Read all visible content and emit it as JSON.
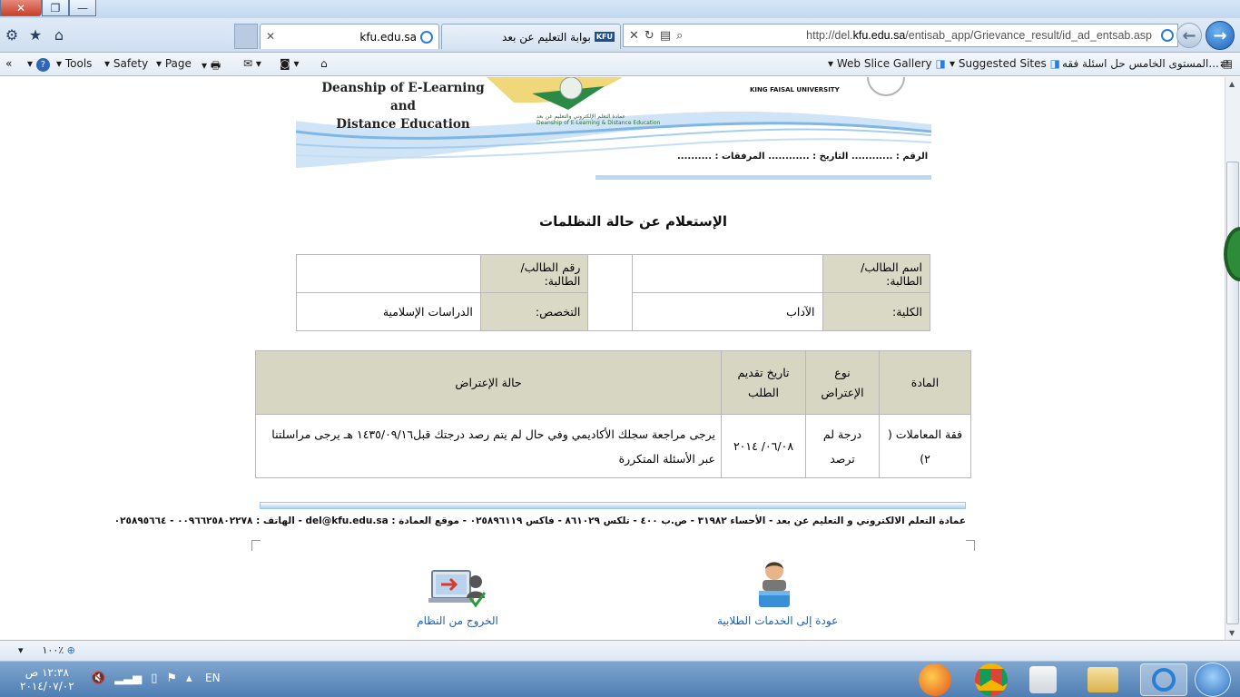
{
  "window": {
    "close_glyph": "✕",
    "restore_glyph": "❐",
    "minimize_glyph": "—"
  },
  "tabs": [
    {
      "label": "kfu.edu.sa",
      "active": true
    },
    {
      "label": "بوابة التعليم عن بعد",
      "active": false
    }
  ],
  "address": {
    "url_prefix": "http://del.",
    "url_domain": "kfu.edu.sa",
    "url_suffix": "/entisab_app/Grievance_result/id_ad_entsab.asp"
  },
  "command_bar": {
    "tools": "Tools",
    "safety": "Safety",
    "page": "Page",
    "web_slice": "Web Slice Gallery",
    "suggested": "Suggested Sites",
    "favorite": "المستوى الخامس حل اسئلة فقه..."
  },
  "letterhead": {
    "dean_line1": "Deanship of E-Learning and",
    "dean_line2": "Distance Education",
    "kfu_en": "KING FAISAL UNIVERSITY",
    "logo_caption_ar": "عمادة التعلم الإلكتروني والتعليم عن بعد",
    "logo_caption_en": "Deanship of E-Learning & Distance Education",
    "meta": "الرقم : ............ التاريخ : ............ المرفقات : .........."
  },
  "page_title": "الإستعلام عن حالة التظلمات",
  "student_info": {
    "name_label": "اسم الطالب/الطالبة:",
    "name_value": "",
    "id_label": "رقم الطالب/الطالبة:",
    "id_value": "",
    "college_label": "الكلية:",
    "college_value": "الآداب",
    "major_label": "التخصص:",
    "major_value": "الدراسات الإسلامية"
  },
  "grievance_table": {
    "headers": {
      "subject": "المادة",
      "type": "نوع الإعتراض",
      "date": "تاريخ تقديم الطلب",
      "status": "حالة الإعتراض"
    },
    "rows": [
      {
        "subject": "فقة المعاملات ( ٢)",
        "type": "درجة لم ترصد",
        "date": "٠٦/٠٨/ ٢٠١٤",
        "status": "يرجى مراجعة سجلك الأكاديمي وفي حال لم يتم رصد درجتك قبل١٤٣٥/٠٩/١٦ هـ يرجى مراسلتنا عبر الأسئلة المتكررة"
      }
    ]
  },
  "footer": {
    "contact": "عمادة التعلم الالكتروني و التعليم عن بعد - الأحساء ٣١٩٨٢ - ص.ب ٤٠٠ - تلكس ٨٦١٠٢٩ - فاكس ٠٢٥٨٩٦١١٩ - موقع العمادة : del@kfu.edu.sa - الهاتف : ٠٠٩٦٦٢٥٨٠٢٢٧٨ - ٠٢٥٨٩٥٦٦٤"
  },
  "services": {
    "back": "عودة إلى الخدمات الطلابية",
    "logout": "الخروج من النظام"
  },
  "statusbar": {
    "zoom": "١٠٠٪"
  },
  "taskbar": {
    "time": "١٢:٣٨ ص",
    "date": "٢٠١٤/٠٧/٠٢",
    "lang": "EN"
  }
}
